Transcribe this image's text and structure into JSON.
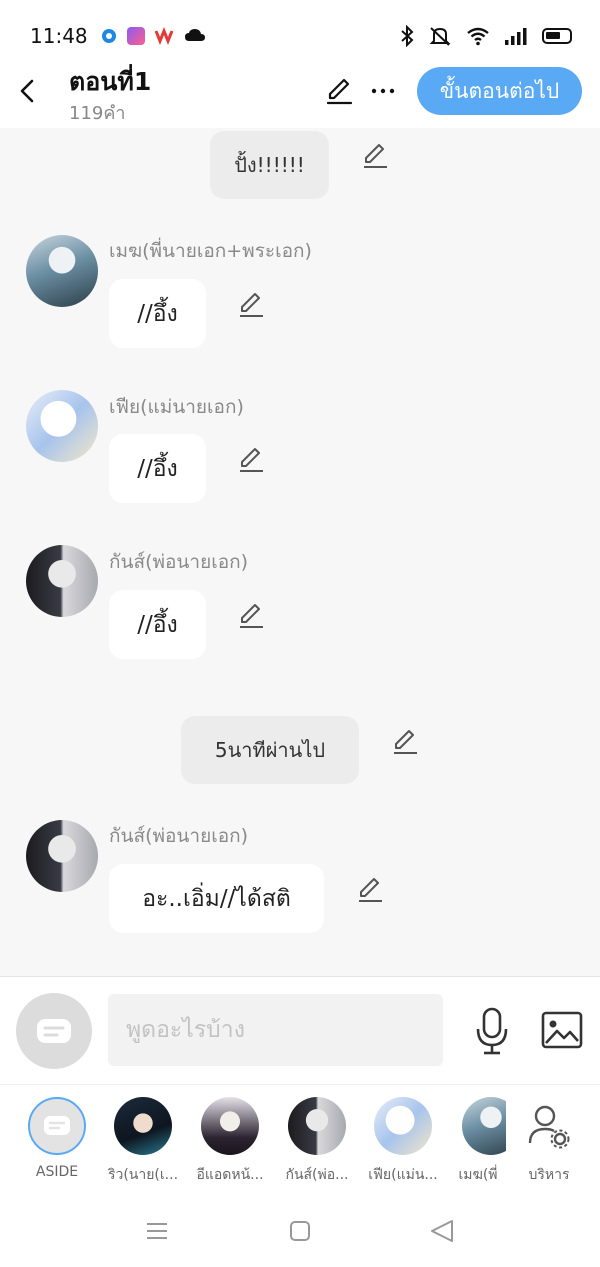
{
  "status_bar": {
    "time": "11:48"
  },
  "header": {
    "title": "ตอนที่1",
    "word_count": "119",
    "word_unit": "คำ",
    "next_label": "ขั้นตอนต่อไป"
  },
  "messages": {
    "narr1": "ปั้ง!!!!!!",
    "m1_name": "เมฆ(พี่นายเอก+พระเอก)",
    "m1_text": "//อึ้ง",
    "m2_name": "เฟีย(แม่นายเอก)",
    "m2_text": "//อึ้ง",
    "m3_name": "กันส์(พ่อนายเอก)",
    "m3_text": "//อึ้ง",
    "narr2": "5นาทีผ่านไป",
    "m4_name": "กันส์(พ่อนายเอก)",
    "m4_text": "อะ..เอิ่ม//ได้สติ"
  },
  "input": {
    "placeholder": "พูดอะไรบ้าง"
  },
  "characters": [
    {
      "label": "ASIDE"
    },
    {
      "label": "ริว(นาย(เ..."
    },
    {
      "label": "อีแอดหน้..."
    },
    {
      "label": "กันส์(พ่อ..."
    },
    {
      "label": "เฟีย(แม่น..."
    },
    {
      "label": "เมฆ(พี่"
    },
    {
      "label": "บริหาร"
    }
  ],
  "colors": {
    "accent": "#5aa9f5",
    "background": "#f7f7f7",
    "narration_bg": "#ececec"
  }
}
